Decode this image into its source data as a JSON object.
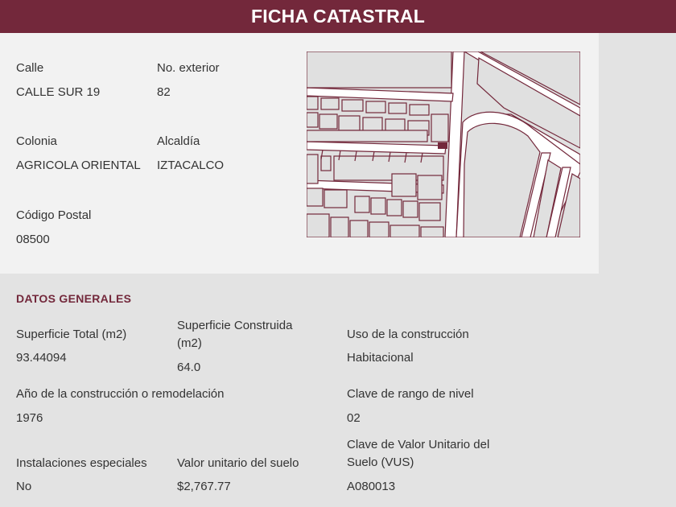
{
  "header": {
    "title": "FICHA CATASTRAL"
  },
  "address": {
    "calle_label": "Calle",
    "calle_value": "CALLE SUR 19",
    "no_exterior_label": "No. exterior",
    "no_exterior_value": "82",
    "colonia_label": "Colonia",
    "colonia_value": "AGRICOLA ORIENTAL",
    "alcaldia_label": "Alcaldía",
    "alcaldia_value": "IZTACALCO",
    "cp_label": "Código Postal",
    "cp_value": "08500"
  },
  "map": {
    "icon": "parcel-map",
    "line_color": "#73283b",
    "fill_color": "#e0e0e0",
    "street_color": "#ffffff"
  },
  "datos_generales": {
    "title": "DATOS GENERALES",
    "superficie_total_label": "Superficie Total (m2)",
    "superficie_total_value": "93.44094",
    "superficie_construida_label": "Superficie Construida (m2)",
    "superficie_construida_value": "64.0",
    "uso_label": "Uso de la construcción",
    "uso_value": "Habitacional",
    "anio_label": "Año de la construcción o remodelación",
    "anio_value": "1976",
    "clave_rango_label": "Clave de rango de nivel",
    "clave_rango_value": "02",
    "instalaciones_label": "Instalaciones especiales",
    "instalaciones_value": "No",
    "valor_unitario_label": "Valor unitario del suelo",
    "valor_unitario_value": "$2,767.77",
    "clave_vus_label": "Clave de Valor Unitario del Suelo (VUS)",
    "clave_vus_value": "A080013"
  },
  "colors": {
    "brand": "#73283b",
    "panel": "#f2f2f2",
    "background": "#e3e3e3",
    "text": "#333333"
  }
}
